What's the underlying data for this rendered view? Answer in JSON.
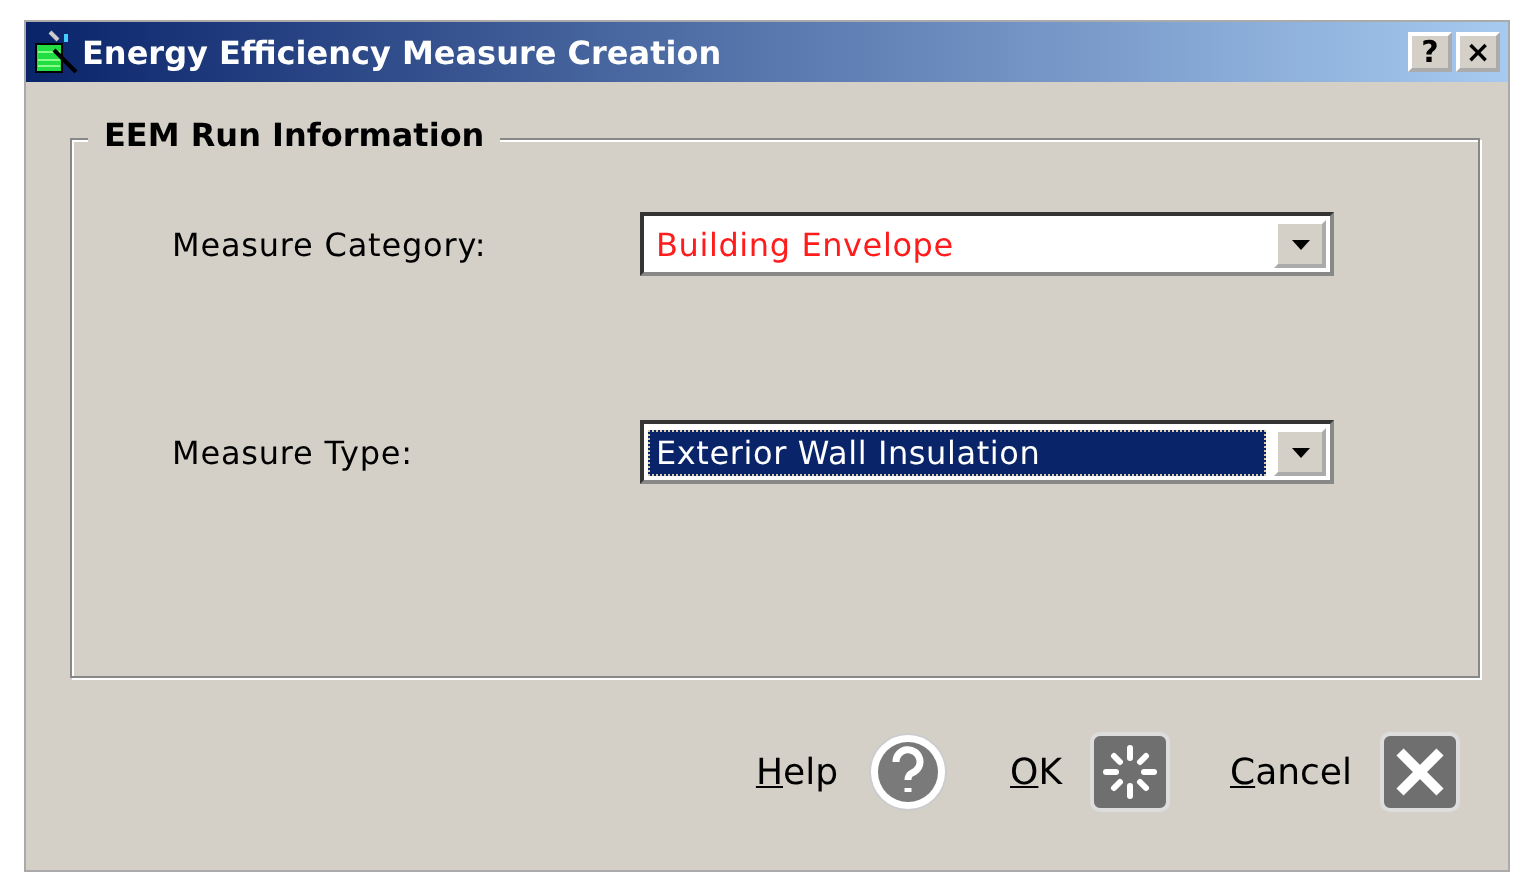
{
  "window": {
    "title": "Energy Efficiency Measure Creation",
    "title_buttons": [
      "?",
      "×"
    ]
  },
  "group": {
    "title": "EEM Run Information",
    "fields": [
      {
        "label": "Measure Category:",
        "value": "Building Envelope",
        "color": "#ff1c1c",
        "focused": false
      },
      {
        "label": "Measure Type:",
        "value": "Exterior Wall Insulation",
        "color": "#ffffff",
        "focused": true
      }
    ]
  },
  "buttons": [
    {
      "kind": "help",
      "key": "H",
      "rest": "elp"
    },
    {
      "kind": "ok",
      "key": "O",
      "rest": "K"
    },
    {
      "kind": "cancel",
      "key": "C",
      "rest": "ancel"
    }
  ]
}
